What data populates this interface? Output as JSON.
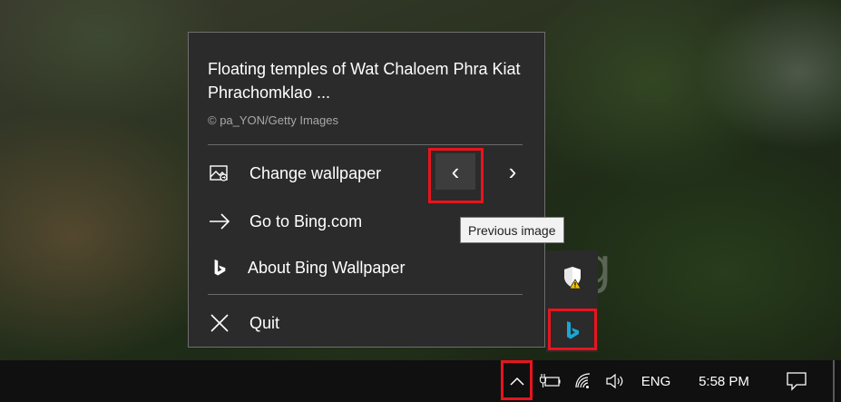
{
  "menu": {
    "title": "Floating temples of Wat Chaloem Phra Kiat Phrachomklao ...",
    "credit": "© pa_YON/Getty Images",
    "items": [
      {
        "label": "Change wallpaper",
        "icon": "image-icon"
      },
      {
        "label": "Go to Bing.com",
        "icon": "arrow-right-icon"
      },
      {
        "label": "About Bing Wallpaper",
        "icon": "bing-logo-icon"
      },
      {
        "label": "Quit",
        "icon": "close-icon"
      }
    ],
    "prev_glyph": "‹",
    "next_glyph": "›"
  },
  "tooltip": {
    "text": "Previous image"
  },
  "wallpaper": {
    "ghost_text": "g"
  },
  "taskbar": {
    "language": "ENG",
    "time": "5:58 PM"
  },
  "colors": {
    "highlight_box": "#e8141d",
    "menu_bg": "#2b2b2b",
    "bing_blue": "#1aa6d6"
  }
}
